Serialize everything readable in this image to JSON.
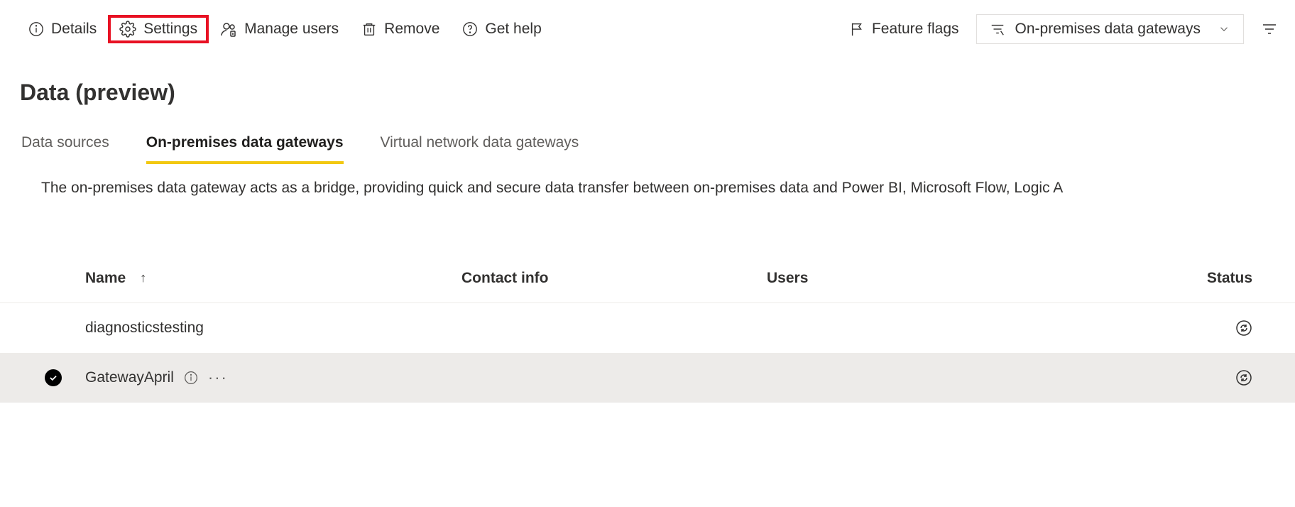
{
  "toolbar": {
    "details": "Details",
    "settings": "Settings",
    "manage_users": "Manage users",
    "remove": "Remove",
    "get_help": "Get help",
    "feature_flags": "Feature flags",
    "filter_dropdown": "On-premises data gateways"
  },
  "page": {
    "title": "Data (preview)"
  },
  "tabs": {
    "data_sources": "Data sources",
    "on_prem": "On-premises data gateways",
    "vnet": "Virtual network data gateways"
  },
  "description": "The on-premises data gateway acts as a bridge, providing quick and secure data transfer between on-premises data and Power BI, Microsoft Flow, Logic A",
  "table": {
    "headers": {
      "name": "Name",
      "contact": "Contact info",
      "users": "Users",
      "status": "Status"
    },
    "rows": [
      {
        "name": "diagnosticstesting",
        "selected": false
      },
      {
        "name": "GatewayApril",
        "selected": true
      }
    ]
  }
}
